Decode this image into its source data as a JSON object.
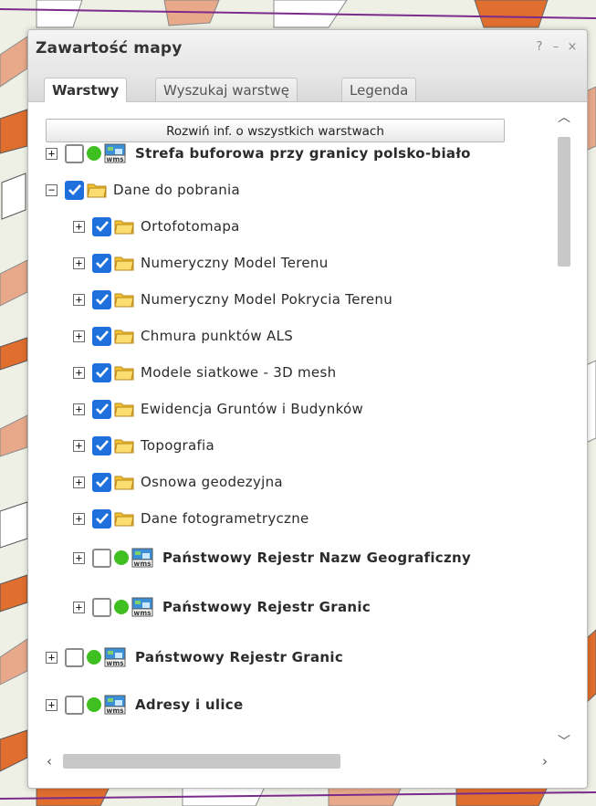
{
  "panel": {
    "title": "Zawartość mapy",
    "help_label": "?",
    "minimize_label": "–",
    "close_label": "×"
  },
  "tabs": [
    {
      "label": "Warstwy",
      "active": true
    },
    {
      "label": "Wyszukaj warstwę",
      "active": false
    },
    {
      "label": "Legenda",
      "active": false
    }
  ],
  "expand_all_label": "Rozwiń inf. o wszystkich warstwach",
  "layers": [
    {
      "label": "Strefa buforowa przy granicy polsko-biało",
      "expander": "+",
      "checked": false,
      "type": "wms",
      "bold": true
    },
    {
      "label": "Dane do pobrania",
      "expander": "−",
      "checked": true,
      "type": "folder",
      "bold": false
    },
    {
      "label": "Ortofotomapa",
      "expander": "+",
      "checked": true,
      "type": "folder",
      "bold": false
    },
    {
      "label": "Numeryczny Model Terenu",
      "expander": "+",
      "checked": true,
      "type": "folder",
      "bold": false
    },
    {
      "label": "Numeryczny Model Pokrycia Terenu",
      "expander": "+",
      "checked": true,
      "type": "folder",
      "bold": false
    },
    {
      "label": "Chmura punktów ALS",
      "expander": "+",
      "checked": true,
      "type": "folder",
      "bold": false
    },
    {
      "label": "Modele siatkowe - 3D mesh",
      "expander": "+",
      "checked": true,
      "type": "folder",
      "bold": false
    },
    {
      "label": "Ewidencja Gruntów i Budynków",
      "expander": "+",
      "checked": true,
      "type": "folder",
      "bold": false
    },
    {
      "label": "Topografia",
      "expander": "+",
      "checked": true,
      "type": "folder",
      "bold": false
    },
    {
      "label": "Osnowa geodezyjna",
      "expander": "+",
      "checked": true,
      "type": "folder",
      "bold": false
    },
    {
      "label": "Dane fotogrametryczne",
      "expander": "+",
      "checked": true,
      "type": "folder",
      "bold": false
    },
    {
      "label": "Państwowy Rejestr Nazw Geograficzny",
      "expander": "+",
      "checked": false,
      "type": "wms",
      "bold": true
    },
    {
      "label": "Państwowy Rejestr Granic",
      "expander": "+",
      "checked": false,
      "type": "wms",
      "bold": true
    },
    {
      "label": "Państwowy Rejestr Granic",
      "expander": "+",
      "checked": false,
      "type": "wms",
      "bold": true
    },
    {
      "label": "Adresy i ulice",
      "expander": "+",
      "checked": false,
      "type": "wms",
      "bold": true
    }
  ],
  "icons": {
    "checkbox_checked_color": "#1f6fdc",
    "status_dot_color": "#40c020",
    "folder_color": "#f2c230"
  }
}
